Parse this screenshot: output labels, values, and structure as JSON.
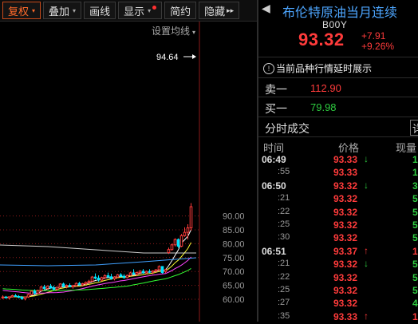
{
  "toolbar": {
    "buttons": [
      {
        "label": "复权",
        "caret": "▾"
      },
      {
        "label": "叠加",
        "caret": "▾"
      },
      {
        "label": "画线"
      },
      {
        "label": "显示",
        "caret": "▾"
      },
      {
        "label": "简约"
      },
      {
        "label": "隐藏",
        "suffix": "▸▸"
      }
    ]
  },
  "chart": {
    "ma_setting_label": "设置均线",
    "ma_setting_caret": "▾",
    "high_label": "94.64",
    "y_ticks": [
      "90.00",
      "85.00",
      "80.00",
      "75.00",
      "70.00",
      "65.00",
      "60.00"
    ],
    "y_values": [
      90,
      85,
      80,
      75,
      70,
      65,
      60
    ],
    "high": 94.64,
    "colors": {
      "up": "#ff3b3b",
      "down": "#00e5ff",
      "grid": "#8b1a1a",
      "ma5": "#ffffff",
      "ma10": "#ffff33",
      "ma20": "#ff44ff",
      "ma60": "#33ff33"
    }
  },
  "quote": {
    "back_icon": "back-arrow",
    "name": "布伦特原油当月连续",
    "code": "B00Y",
    "last": "93.32",
    "change": "+7.91",
    "change_pct": "+9.26%",
    "notice": "当前品种行情延时展示",
    "ask_label": "卖一",
    "ask_price": "112.90",
    "bid_label": "买一",
    "bid_price": "79.98",
    "ticks_title": "分时成交",
    "ticks_tab": "详",
    "headers": {
      "time": "时间",
      "price": "价格",
      "volume": "现量"
    },
    "ticks": [
      {
        "time": "06:49",
        "price": "93.33",
        "dir": "down",
        "vol": "1",
        "vol_color": "g"
      },
      {
        "time": ":55",
        "price": "93.33",
        "dir": "",
        "vol": "1",
        "vol_color": "g"
      },
      {
        "time": "06:50",
        "price": "93.32",
        "dir": "down",
        "vol": "3",
        "vol_color": "g"
      },
      {
        "time": ":21",
        "price": "93.32",
        "dir": "",
        "vol": "5",
        "vol_color": "g"
      },
      {
        "time": ":22",
        "price": "93.32",
        "dir": "",
        "vol": "5",
        "vol_color": "g"
      },
      {
        "time": ":25",
        "price": "93.32",
        "dir": "",
        "vol": "5",
        "vol_color": "g"
      },
      {
        "time": ":30",
        "price": "93.32",
        "dir": "",
        "vol": "5",
        "vol_color": "g"
      },
      {
        "time": "06:51",
        "price": "93.37",
        "dir": "up",
        "vol": "1",
        "vol_color": "r"
      },
      {
        "time": ":21",
        "price": "93.32",
        "dir": "down",
        "vol": "5",
        "vol_color": "g"
      },
      {
        "time": ":22",
        "price": "93.32",
        "dir": "",
        "vol": "5",
        "vol_color": "g"
      },
      {
        "time": ":25",
        "price": "93.32",
        "dir": "",
        "vol": "5",
        "vol_color": "g"
      },
      {
        "time": ":27",
        "price": "93.32",
        "dir": "",
        "vol": "4",
        "vol_color": "g"
      },
      {
        "time": ":35",
        "price": "93.33",
        "dir": "up",
        "vol": "1",
        "vol_color": "r"
      }
    ]
  }
}
